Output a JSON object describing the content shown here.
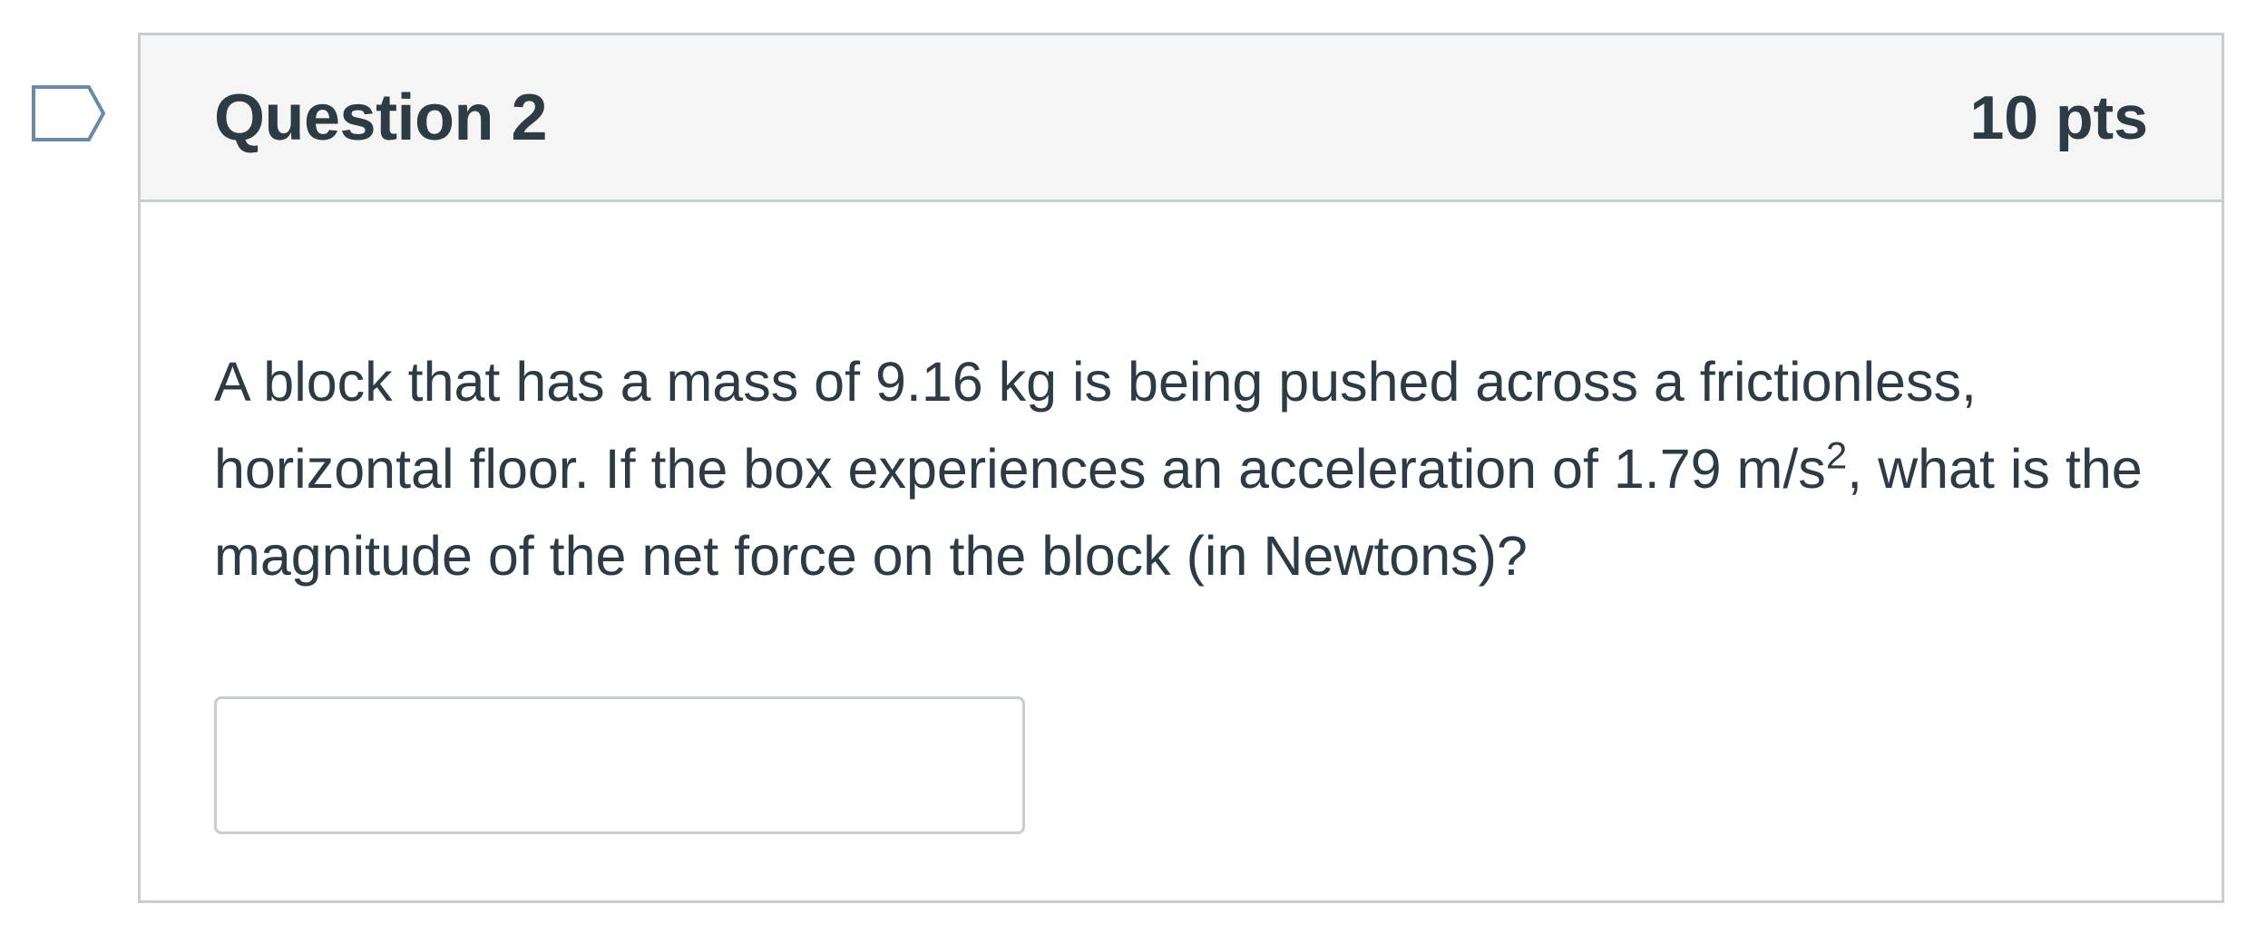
{
  "question": {
    "title": "Question 2",
    "points": "10 pts",
    "text_parts": {
      "before_superscript": "A block that has a mass of 9.16 kg is being pushed across a frictionless, horizontal floor.  If the box experiences an acceleration of 1.79 m/s",
      "superscript": "2",
      "after_superscript": ", what is the magnitude of the net force on the block (in Newtons)?"
    },
    "answer": {
      "value": "",
      "placeholder": ""
    }
  },
  "icons": {
    "flag": "bookmark-flag-icon"
  },
  "colors": {
    "text": "#2d3b45",
    "border": "#c7cdd1",
    "header_bg": "#f5f5f5",
    "flag_stroke": "#6a8aa8"
  }
}
